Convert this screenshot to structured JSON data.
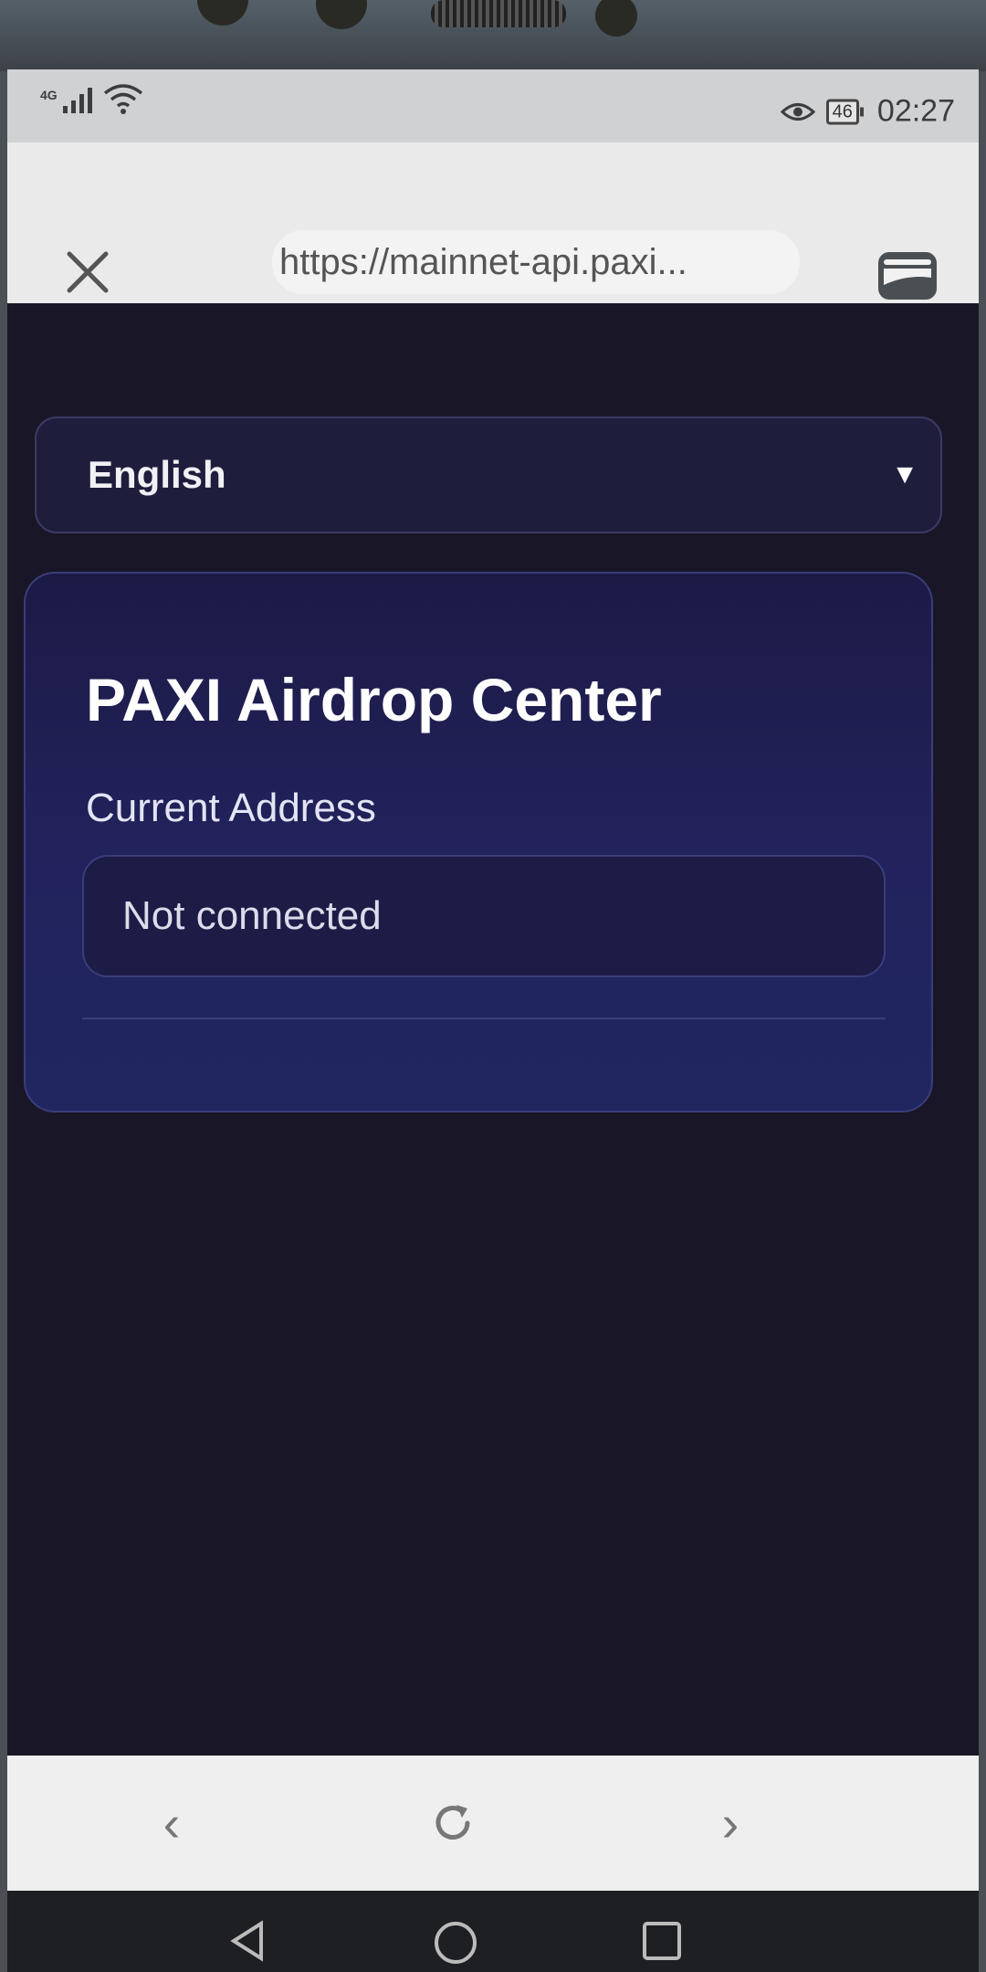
{
  "status_bar": {
    "network": "4G",
    "battery": "46",
    "time": "02:27"
  },
  "browser": {
    "url": "https://mainnet-api.paxi..."
  },
  "page": {
    "language_select": {
      "value": "English"
    },
    "card": {
      "title": "PAXI Airdrop Center",
      "address_label": "Current Address",
      "address_value": "Not connected"
    }
  },
  "bottom_nav": {
    "back": "‹",
    "forward": "›"
  },
  "icons": {
    "close": "close-icon",
    "wallet": "wallet-icon",
    "reload": "reload-icon",
    "eye": "eye-comfort-icon",
    "signal": "signal-icon",
    "wifi": "wifi-icon"
  },
  "colors": {
    "page_bg": "#191627",
    "card_bg": "#22235e",
    "accent_border": "#3a3d7a"
  }
}
